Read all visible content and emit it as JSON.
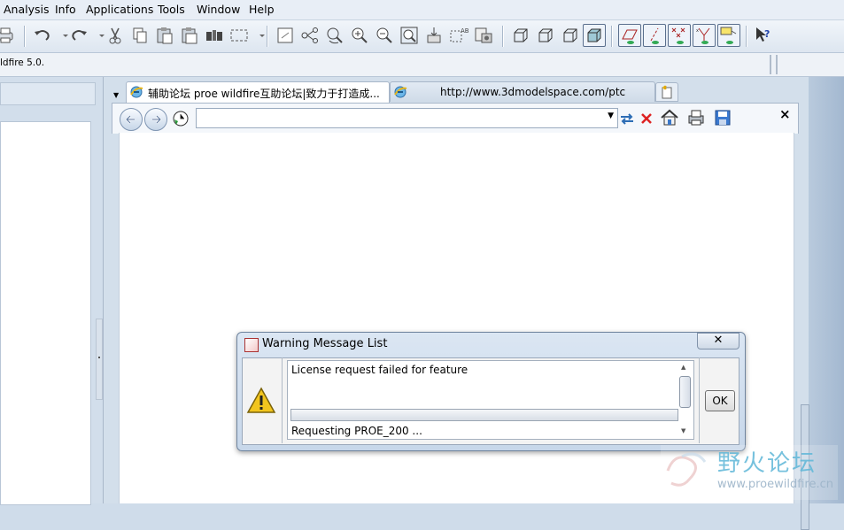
{
  "menu": {
    "items": [
      "Analysis",
      "Info",
      "Applications",
      "Tools",
      "Window",
      "Help"
    ]
  },
  "toolbar": {
    "icons": [
      "print-icon",
      "undo-icon",
      "redo-icon",
      "cut-icon",
      "copy-icon",
      "paste-icon",
      "paste-special-icon",
      "regenerate-icon",
      "select-box-icon",
      "refit-icon",
      "spin-center-icon",
      "orient-icon",
      "zoom-in-icon",
      "zoom-out-icon",
      "zoom-fit-icon",
      "repaint-icon",
      "saved-views-icon",
      "layers-icon",
      "wireframe-icon",
      "hidden-line-icon",
      "no-hidden-icon",
      "shading-icon",
      "datum-planes-icon",
      "datum-axes-icon",
      "datum-points-icon",
      "coordinate-systems-icon",
      "annotations-icon",
      "context-help-icon"
    ]
  },
  "message_line": {
    "text": "ldfire 5.0."
  },
  "browser": {
    "tab1_label": "辅助论坛 proe wildfire互助论坛|致力于打造成...",
    "tab2_label": "http://www.3dmodelspace.com/ptc",
    "url_value": "",
    "close_label": "×"
  },
  "dialog": {
    "title": "Warning Message List",
    "close_label": "✕",
    "message": "License request failed for feature",
    "status": "Requesting PROE_200 ...",
    "ok_label": "OK"
  },
  "watermark": {
    "title": "野火论坛",
    "url": "www.proewildfire.cn"
  }
}
